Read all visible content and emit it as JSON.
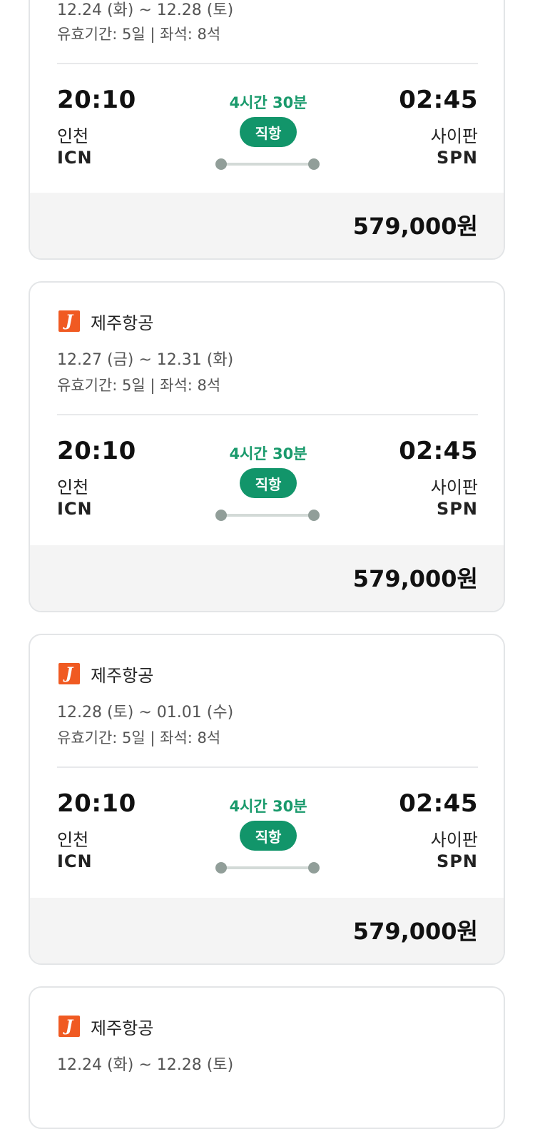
{
  "cards": [
    {
      "airline": "",
      "dates": "12.24 (화) ~ 12.28 (토)",
      "validity": "유효기간: 5일 | 좌석: 8석",
      "departure": {
        "time": "20:10",
        "city": "인천",
        "code": "ICN"
      },
      "arrival": {
        "time": "02:45",
        "city": "사이판",
        "code": "SPN"
      },
      "duration": "4시간 30분",
      "flight_type": "직항",
      "price": "579,000원"
    },
    {
      "airline": "제주항공",
      "dates": "12.27 (금) ~ 12.31 (화)",
      "validity": "유효기간: 5일 | 좌석: 8석",
      "departure": {
        "time": "20:10",
        "city": "인천",
        "code": "ICN"
      },
      "arrival": {
        "time": "02:45",
        "city": "사이판",
        "code": "SPN"
      },
      "duration": "4시간 30분",
      "flight_type": "직항",
      "price": "579,000원"
    },
    {
      "airline": "제주항공",
      "dates": "12.28 (토) ~ 01.01 (수)",
      "validity": "유효기간: 5일 | 좌석: 8석",
      "departure": {
        "time": "20:10",
        "city": "인천",
        "code": "ICN"
      },
      "arrival": {
        "time": "02:45",
        "city": "사이판",
        "code": "SPN"
      },
      "duration": "4시간 30분",
      "flight_type": "직항",
      "price": "579,000원"
    },
    {
      "airline": "제주항공",
      "dates": "12.24 (화) ~ 12.28 (토)"
    }
  ],
  "airline_logo_letter": "J",
  "colors": {
    "accent_green": "#12956a",
    "duration_green": "#1a9a6c",
    "logo_orange": "#f05a22",
    "price_bar_bg": "#f4f4f4",
    "card_border": "#e3e5e7"
  }
}
